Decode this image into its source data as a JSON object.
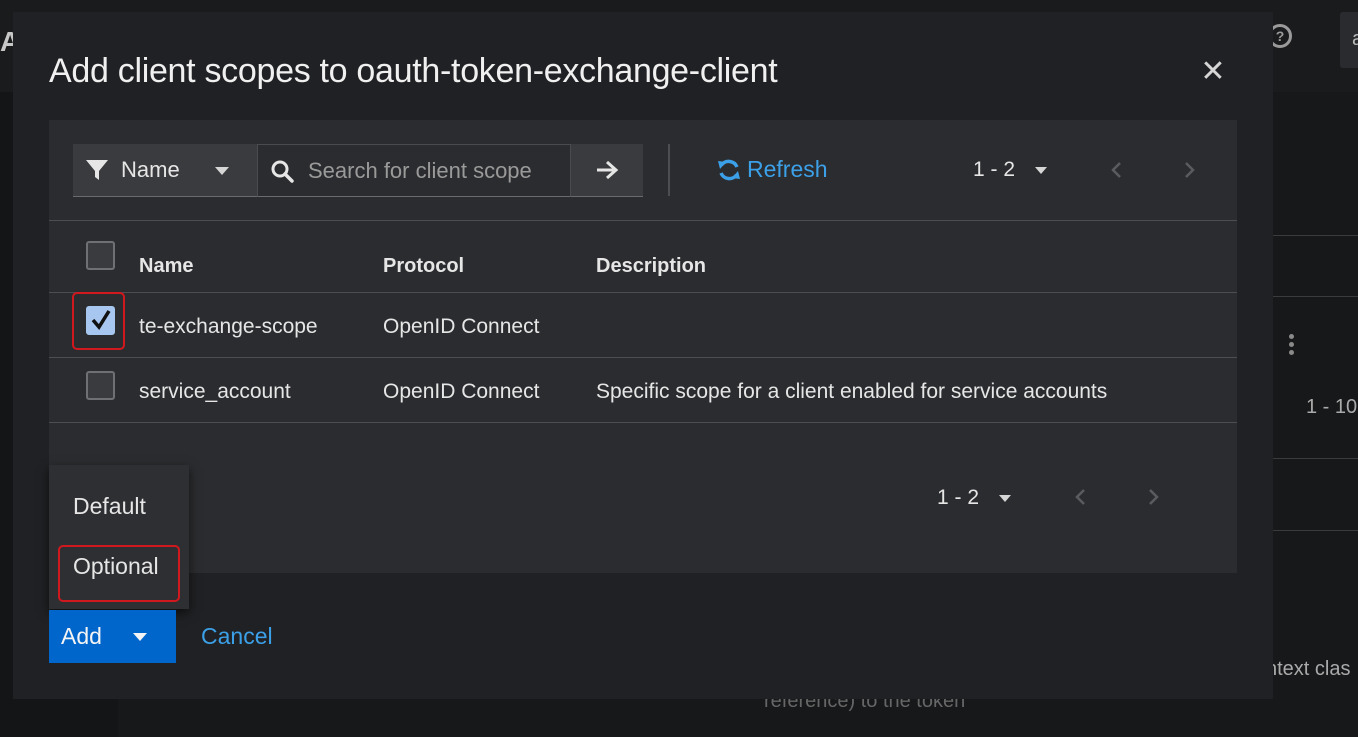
{
  "background": {
    "app_title_fragment": "Al",
    "help_icon_glyph": "?",
    "user_menu_fragment": "a",
    "pager_text": "1 - 10",
    "row_text_fragment": "ntext clas",
    "row_text_fragment_2": "reference) to the token"
  },
  "modal": {
    "title": "Add client scopes to oauth-token-exchange-client",
    "close_icon": "close-icon",
    "toolbar": {
      "filter_label": "Name",
      "filter_icon": "filter-icon",
      "search_placeholder": "Search for client scope",
      "search_value": "",
      "refresh_label": "Refresh",
      "pagination_label": "1 - 2"
    },
    "table": {
      "columns": [
        "Name",
        "Protocol",
        "Description"
      ],
      "rows": [
        {
          "name": "te-exchange-scope",
          "protocol": "OpenID Connect",
          "description": "",
          "checked": true
        },
        {
          "name": "service_account",
          "protocol": "OpenID Connect",
          "description": "Specific scope for a client enabled for service accounts",
          "checked": false
        }
      ]
    },
    "footer_pagination_label": "1 - 2",
    "add_menu": {
      "items": [
        "Default",
        "Optional"
      ]
    },
    "buttons": {
      "add_label": "Add",
      "cancel_label": "Cancel"
    }
  },
  "colors": {
    "primary": "#0066cc",
    "link": "#3ca0e8",
    "highlight": "#d0181e",
    "modal_bg": "#202124",
    "panel_bg": "#2b2c2f"
  }
}
